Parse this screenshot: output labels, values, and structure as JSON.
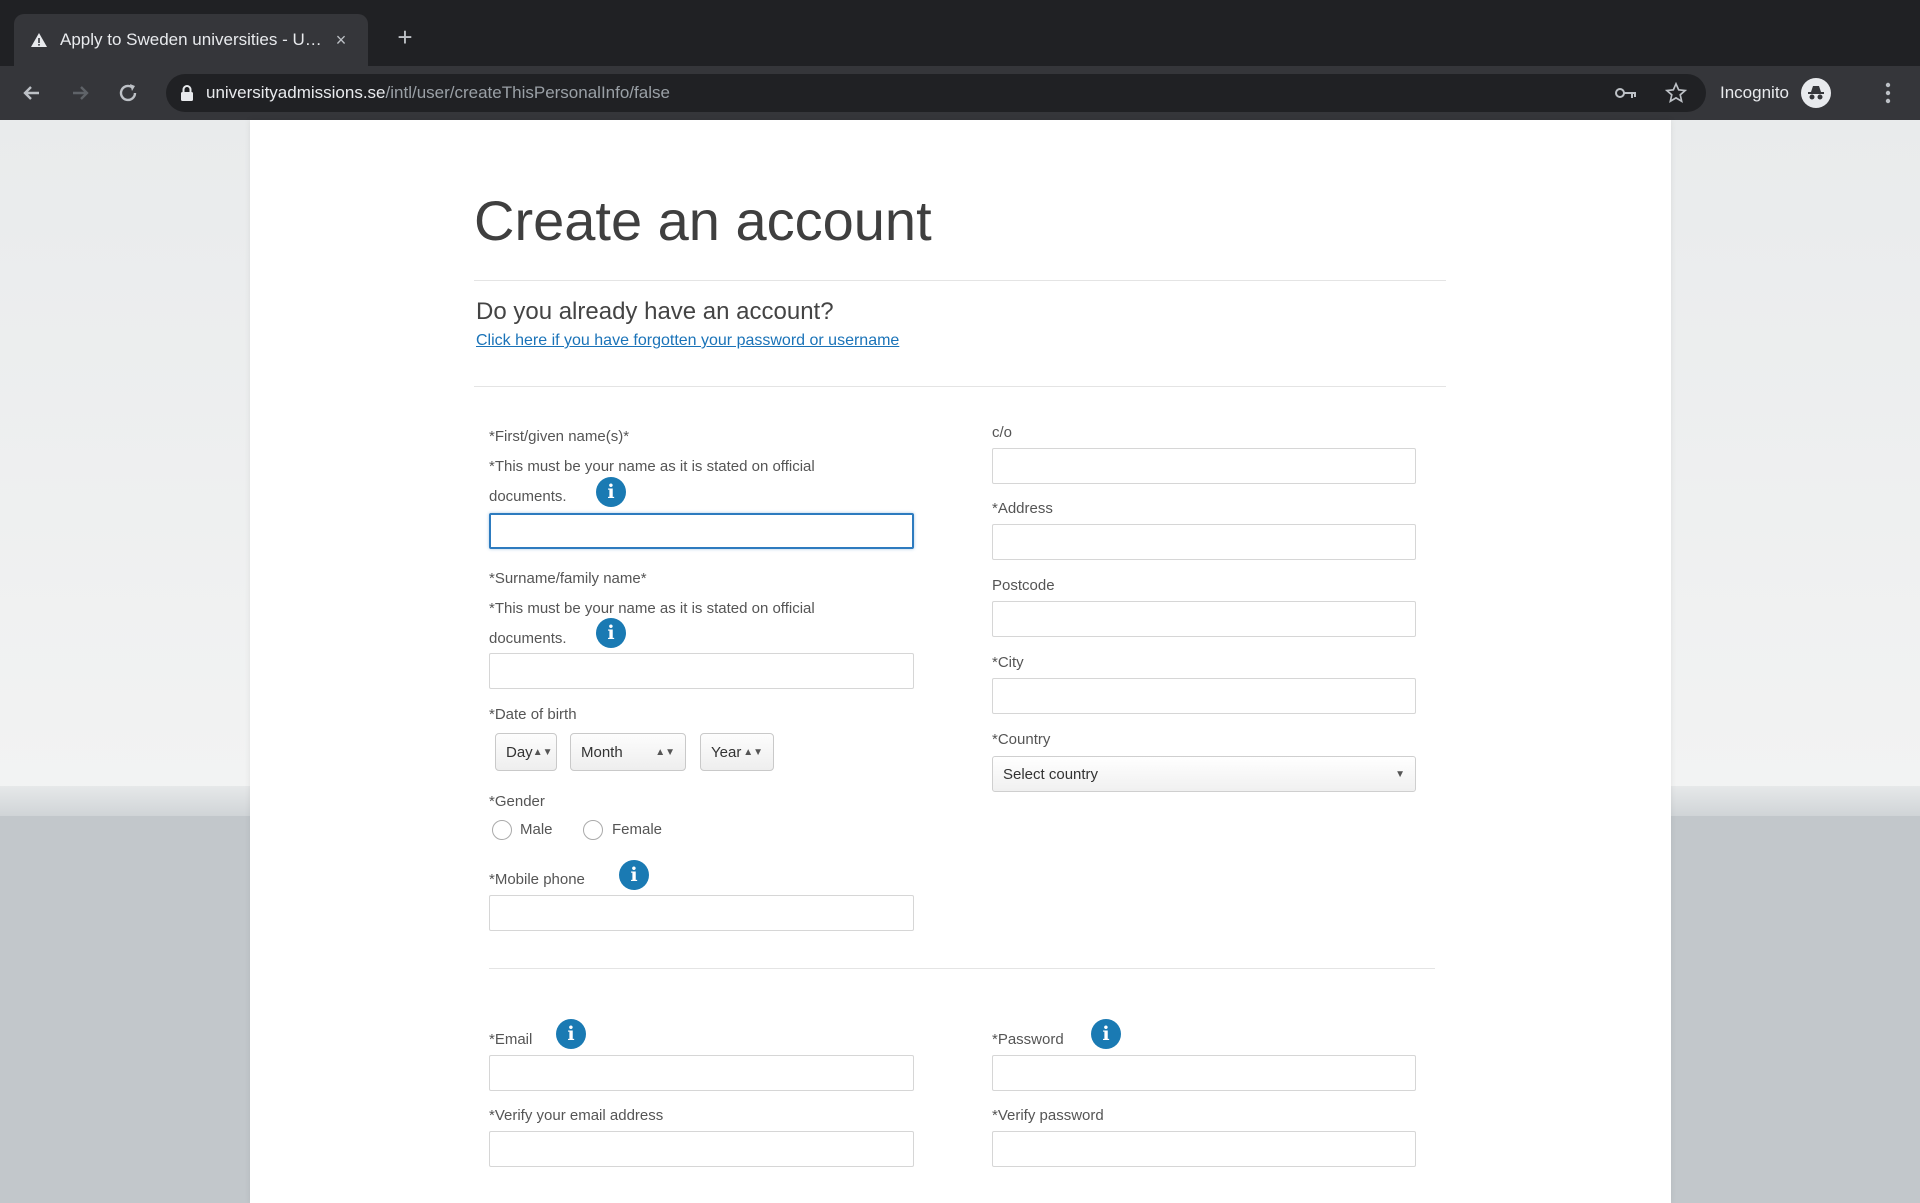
{
  "browser": {
    "tab_title": "Apply to Sweden universities - University Admissions",
    "tab_close": "×",
    "new_tab": "+",
    "url_domain": "universityadmissions.se",
    "url_path": "/intl/user/createThisPersonalInfo/false",
    "profile_label": "Incognito"
  },
  "page": {
    "title": "Create an account",
    "already_heading": "Do you already have an account?",
    "forgot_link": "Click here if you have forgotten your password or username"
  },
  "form": {
    "first_name_label": "*First/given name(s)*",
    "first_name_note": "*This must be your name as it is stated on official documents.",
    "surname_label": "*Surname/family name*",
    "surname_note": "*This must be your name as it is stated on official documents.",
    "dob_label": "*Date of birth",
    "dob_day": "Day",
    "dob_month": "Month",
    "dob_year": "Year",
    "gender_label": "*Gender",
    "gender_male": "Male",
    "gender_female": "Female",
    "mobile_label": "*Mobile phone",
    "co_label": "c/o",
    "address_label": "*Address",
    "postcode_label": "Postcode",
    "city_label": "*City",
    "country_label": "*Country",
    "country_placeholder": "Select country",
    "email_label": "*Email",
    "verify_email_label": "*Verify your email address",
    "password_label": "*Password",
    "verify_password_label": "*Verify password",
    "info_glyph": "i"
  },
  "colors": {
    "accent": "#1a7ab3",
    "link": "#1a73b8",
    "focus_border": "#2d7bbf"
  },
  "icons": [
    "warning-favicon-icon",
    "close-icon",
    "plus-icon",
    "back-arrow-icon",
    "forward-arrow-icon",
    "reload-icon",
    "lock-icon",
    "key-icon",
    "star-icon",
    "incognito-avatar-icon",
    "kebab-menu-icon",
    "info-icon"
  ]
}
